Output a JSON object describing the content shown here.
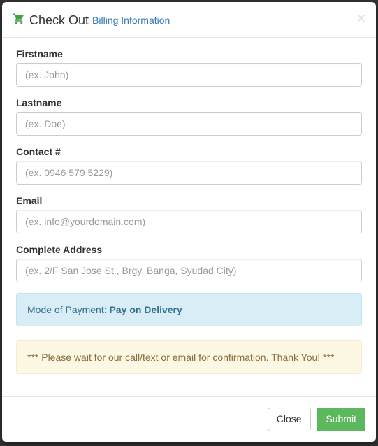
{
  "header": {
    "title": "Check Out",
    "subtitle": "Billing Information",
    "close": "×"
  },
  "form": {
    "firstname": {
      "label": "Firstname",
      "placeholder": "(ex. John)",
      "value": ""
    },
    "lastname": {
      "label": "Lastname",
      "placeholder": "(ex. Doe)",
      "value": ""
    },
    "contact": {
      "label": "Contact #",
      "placeholder": "(ex. 0946 579 5229)",
      "value": ""
    },
    "email": {
      "label": "Email",
      "placeholder": "(ex. info@yourdomain.com)",
      "value": ""
    },
    "address": {
      "label": "Complete Address",
      "placeholder": "(ex. 2/F San Jose St., Brgy. Banga, Syudad City)",
      "value": ""
    }
  },
  "alerts": {
    "payment_label": "Mode of Payment: ",
    "payment_value": "Pay on Delivery",
    "confirmation": "*** Please wait for our call/text or email for confirmation. Thank You! ***"
  },
  "footer": {
    "close_label": "Close",
    "submit_label": "Submit"
  },
  "colors": {
    "cart_icon": "#449d44",
    "link": "#337ab7",
    "info_bg": "#d9edf7",
    "warning_bg": "#fcf8e3",
    "success_btn": "#5cb85c"
  }
}
